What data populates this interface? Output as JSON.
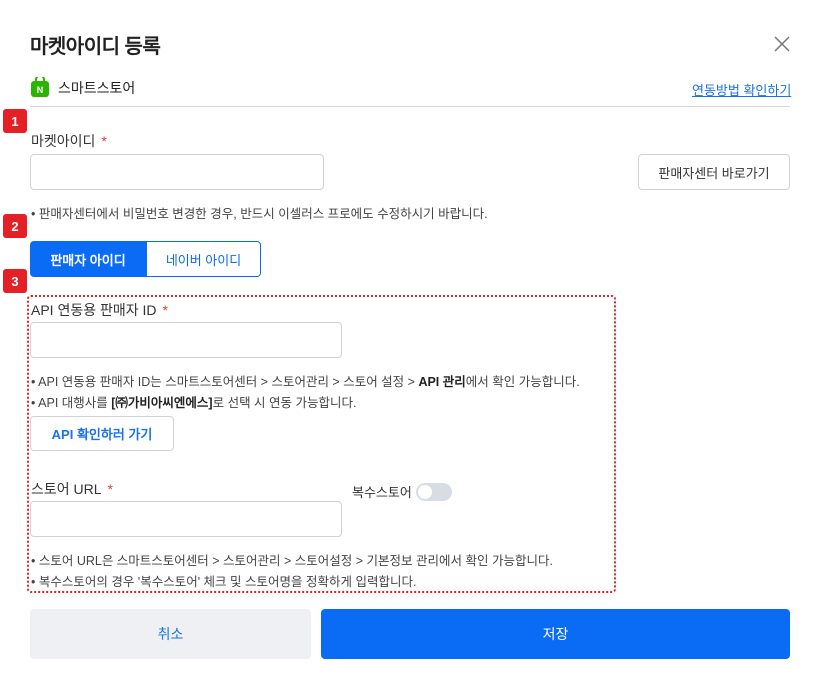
{
  "dialog": {
    "title": "마켓아이디 등록",
    "close_icon": "close-icon"
  },
  "store": {
    "name": "스마트스토어",
    "logo_icon": "naver-smartstore-logo",
    "logo_color": "#2db400",
    "guide_link": "연동방법 확인하기"
  },
  "badges": [
    "1",
    "2",
    "3"
  ],
  "market_id": {
    "label": "마켓아이디",
    "required_mark": "*",
    "value": "",
    "seller_center_button": "판매자센터 바로가기",
    "note": "판매자센터에서 비밀번호 변경한 경우, 반드시 이셀러스 프로에도 수정하시기 바랍니다."
  },
  "id_type_tabs": {
    "active": "판매자 아이디",
    "inactive": "네이버 아이디"
  },
  "api_section": {
    "label": "API 연동용 판매자 ID",
    "required_mark": "*",
    "value": "",
    "note1_prefix": "API 연동용 판매자 ID는 스마트스토어센터 > 스토어관리 > 스토어 설정 > ",
    "note1_bold": "API 관리",
    "note1_suffix": "에서 확인 가능합니다.",
    "note2_prefix": "API 대행사를 ",
    "note2_bold": "[㈜가비아씨엔에스]",
    "note2_suffix": "로 선택 시 연동 가능합니다.",
    "check_button": "API 확인하러 가기"
  },
  "store_url": {
    "label": "스토어 URL",
    "required_mark": "*",
    "value": "",
    "multi_store_label": "복수스토어",
    "multi_store_enabled": false,
    "note1": "스토어 URL은 스마트스토어센터 > 스토어관리 > 스토어설정 > 기본정보 관리에서 확인 가능합니다.",
    "note2": "복수스토어의 경우 '복수스토어' 체크 및 스토어명을 정확하게 입력합니다."
  },
  "footer": {
    "cancel": "취소",
    "save": "저장"
  },
  "colors": {
    "primary": "#0a6cf5",
    "badge": "#e51f26",
    "link": "#1a73e8"
  }
}
